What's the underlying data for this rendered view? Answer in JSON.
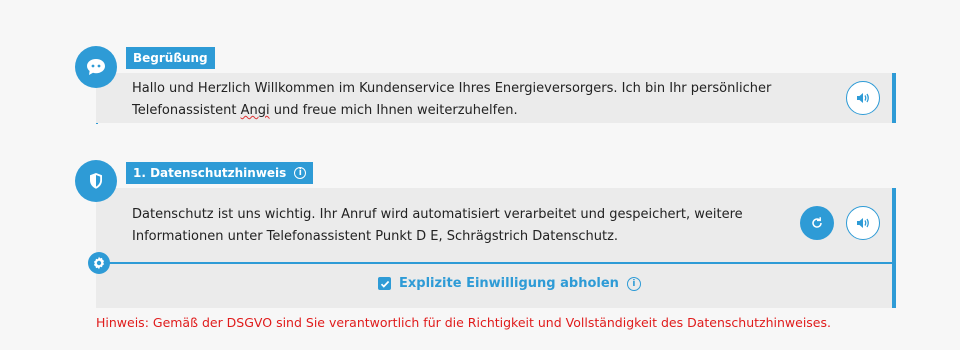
{
  "greeting": {
    "tag_label": "Begrüßung",
    "text_before": "Hallo und Herzlich Willkommen im Kundenservice Ihres Energieversorgers. Ich bin Ihr persönlicher Telefonassistent ",
    "text_misspelled": "Angi",
    "text_after": " und freue mich Ihnen weiterzuhelfen.",
    "icon": "chat-bubble-icon",
    "speaker_icon": "speaker-icon"
  },
  "privacy": {
    "tag_label": "1. Datenschutzhinweis",
    "info_symbol": "i",
    "text": "Datenschutz ist uns wichtig. Ihr Anruf wird automatisiert verarbeitet und gespeichert, weitere Informationen unter Telefonassistent Punkt D E, Schrägstrich Datenschutz.",
    "icon": "shield-icon",
    "reset_icon": "refresh-icon",
    "speaker_icon": "speaker-icon",
    "settings_icon": "gear-icon",
    "consent_label": "Explizite Einwilligung abholen",
    "consent_checked": true,
    "consent_info_symbol": "i"
  },
  "warning_text": "Hinweis: Gemäß der DSGVO sind Sie verantwortlich für die Richtigkeit und Vollständigkeit des Datenschutzhinweises.",
  "colors": {
    "accent": "#2e9bd6",
    "warning": "#e01b1b",
    "panel_bg": "#ebebeb"
  }
}
